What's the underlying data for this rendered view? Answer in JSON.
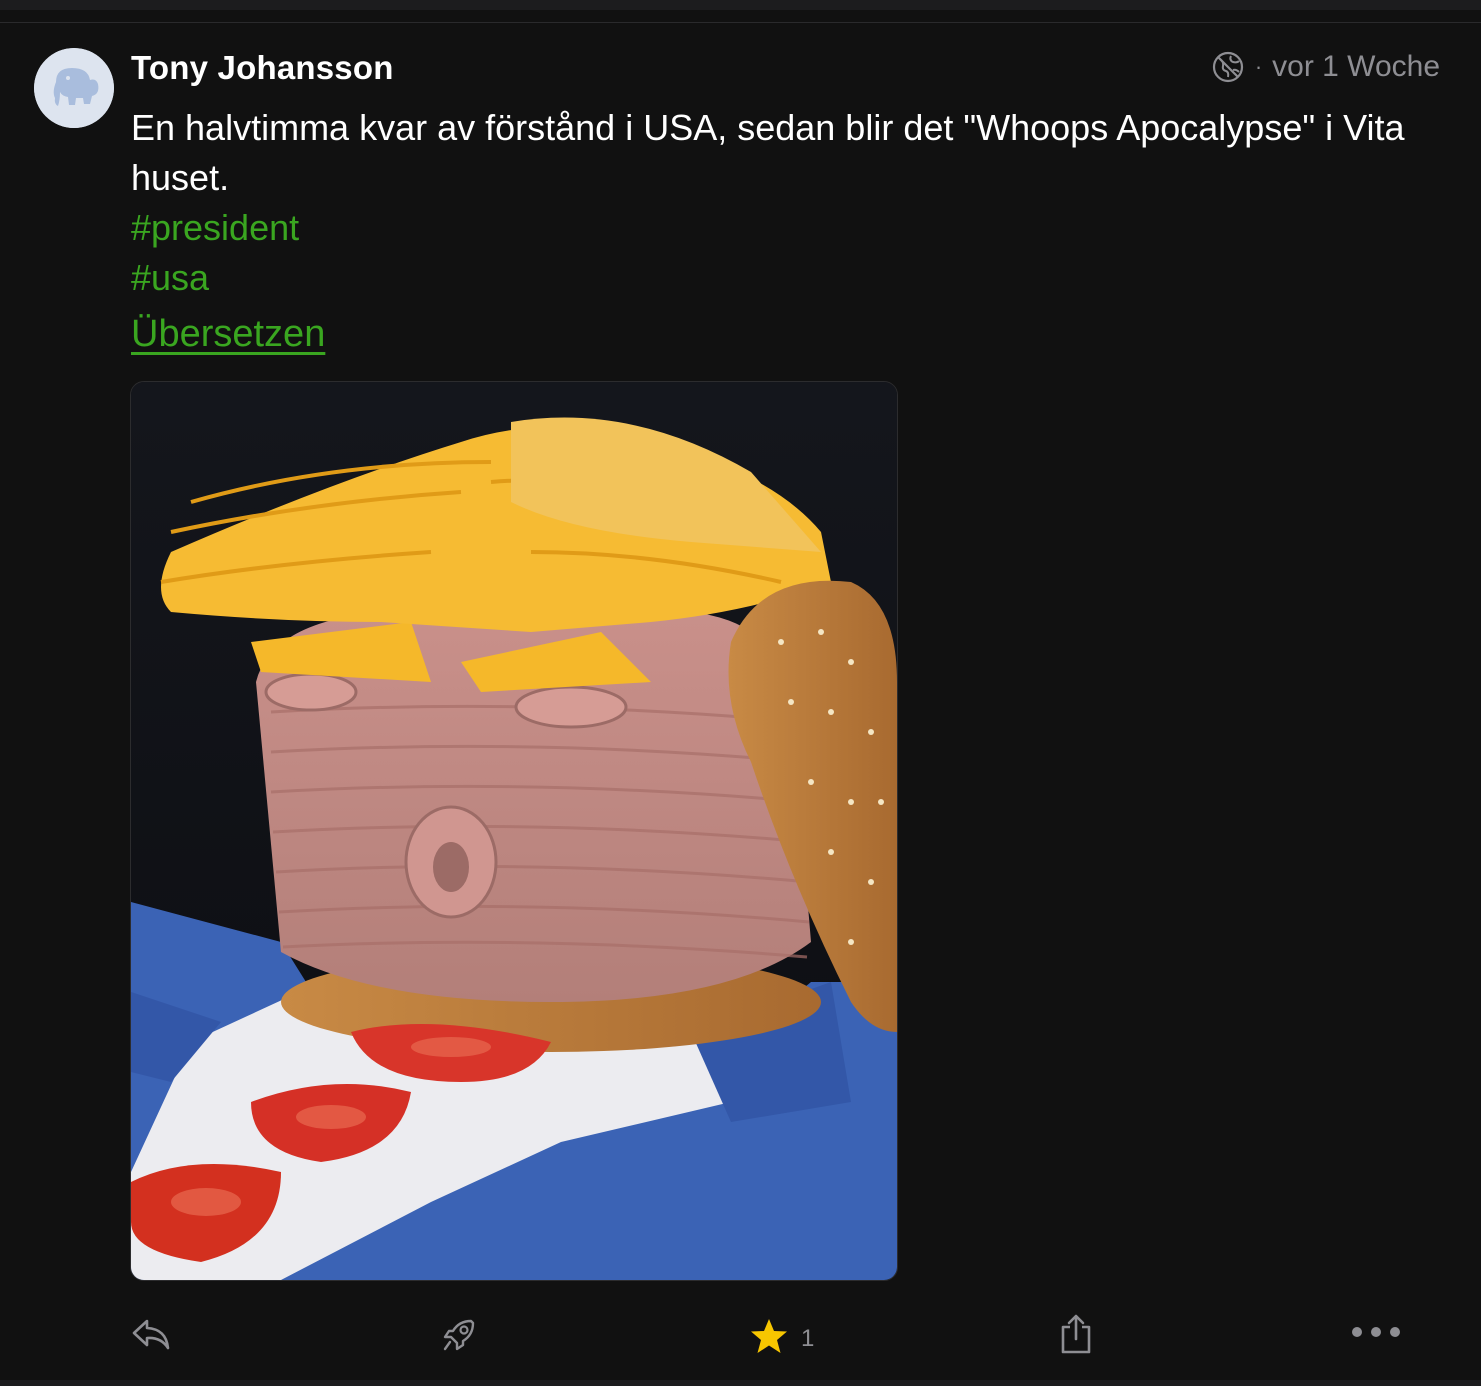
{
  "post": {
    "author_name": "Tony Johansson",
    "timestamp": "vor 1 Woche",
    "separator": "·",
    "visibility_icon": "globe-slash-icon",
    "text": "En halvtimma kvar av förstånd i USA, sedan blir det \"Whoops Apocalypse\" i Vita huset.",
    "hashtags": [
      "#president",
      "#usa"
    ],
    "translate_label": "Übersetzen",
    "colors": {
      "background": "#111111",
      "accent_green": "#3aa620",
      "muted": "#8e8e93",
      "favourite_star": "#f7c600"
    }
  },
  "actions": {
    "reply_icon": "reply-icon",
    "boost_icon": "rocket-icon",
    "favourite_icon": "star-icon",
    "favourite_count": "1",
    "share_icon": "share-icon",
    "more_icon": "more-icon"
  }
}
